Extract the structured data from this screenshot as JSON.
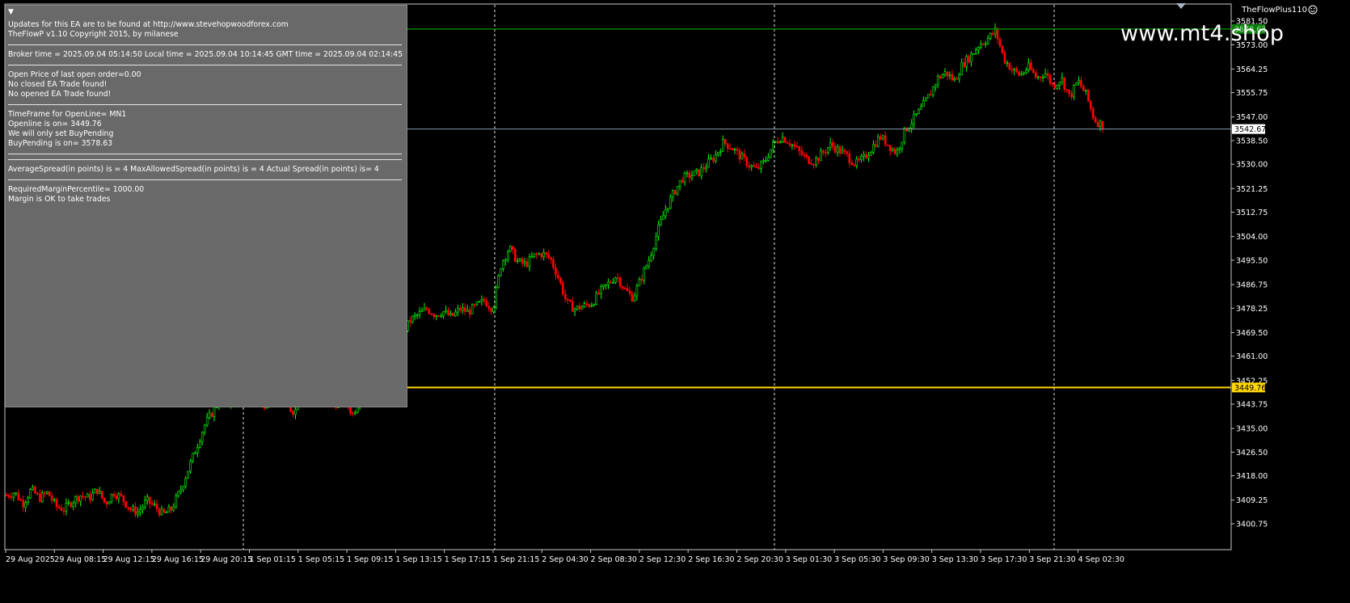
{
  "chart": {
    "indicator_name": "TheFlowPlus110",
    "watermark": "www.mt4.shop",
    "price_axis": {
      "ticks": [
        "3581.50",
        "3573.00",
        "3564.25",
        "3555.75",
        "3547.00",
        "3538.50",
        "3530.00",
        "3521.25",
        "3512.75",
        "3504.00",
        "3495.50",
        "3486.75",
        "3478.25",
        "3469.50",
        "3461.00",
        "3452.25",
        "3443.75",
        "3435.00",
        "3426.50",
        "3418.00",
        "3409.25",
        "3400.75"
      ]
    },
    "time_axis": {
      "labels": [
        "29 Aug 2025",
        "29 Aug 08:15",
        "29 Aug 12:15",
        "29 Aug 16:15",
        "29 Aug 20:15",
        "1 Sep 01:15",
        "1 Sep 05:15",
        "1 Sep 09:15",
        "1 Sep 13:15",
        "1 Sep 17:15",
        "1 Sep 21:15",
        "2 Sep 04:30",
        "2 Sep 08:30",
        "2 Sep 12:30",
        "2 Sep 16:30",
        "2 Sep 20:30",
        "3 Sep 01:30",
        "3 Sep 05:30",
        "3 Sep 09:30",
        "3 Sep 13:30",
        "3 Sep 17:30",
        "3 Sep 21:30",
        "4 Sep 02:30"
      ]
    },
    "lines": {
      "buy_pending": {
        "price": 3578.63,
        "label": "3578.63",
        "color": "#008000"
      },
      "current_price": {
        "price": 3542.67,
        "label": "3542.67",
        "color": "#8a9cb0"
      },
      "open_line": {
        "price": 3449.76,
        "label": "3449.76",
        "color": "#ffd700"
      }
    },
    "colors": {
      "background": "#000000",
      "bull": "#00ff00",
      "bear": "#ff0000",
      "grid": "#ffffff",
      "axis_text": "#ffffff"
    },
    "series_path": [
      3411,
      3412,
      3408,
      3413,
      3410,
      3412,
      3407,
      3406,
      3409,
      3411,
      3410,
      3413,
      3408,
      3412,
      3410,
      3406,
      3405,
      3409,
      3407,
      3404,
      3406,
      3412,
      3420,
      3428,
      3436,
      3441,
      3446,
      3444,
      3448,
      3445,
      3447,
      3443,
      3446,
      3448,
      3443,
      3441,
      3452,
      3446,
      3450,
      3448,
      3444,
      3446,
      3440,
      3447,
      3466,
      3471,
      3467,
      3470,
      3469,
      3474,
      3476,
      3478,
      3476,
      3477,
      3475,
      3478,
      3477,
      3479,
      3481,
      3478,
      3494,
      3500,
      3495,
      3494,
      3497,
      3498,
      3496,
      3489,
      3480,
      3478,
      3479,
      3480,
      3484,
      3487,
      3490,
      3485,
      3482,
      3489,
      3496,
      3506,
      3514,
      3520,
      3525,
      3526,
      3527,
      3530,
      3533,
      3538,
      3536,
      3533,
      3530,
      3528,
      3531,
      3537,
      3540,
      3538,
      3535,
      3532,
      3531,
      3534,
      3537,
      3535,
      3533,
      3530,
      3532,
      3536,
      3540,
      3537,
      3534,
      3542,
      3546,
      3550,
      3555,
      3561,
      3563,
      3560,
      3566,
      3569,
      3573,
      3575,
      3578,
      3568,
      3564,
      3562,
      3565,
      3561,
      3563,
      3558,
      3561,
      3554,
      3560,
      3555,
      3546,
      3544
    ],
    "vertical_grid_x": [
      301,
      612,
      958,
      1304
    ]
  },
  "panel": {
    "lines": [
      "Updates for this EA are to be found at http://www.stevehopwoodforex.com",
      "TheFlowP   v1.10 Copyright 2015, by milanese",
      "---",
      "Broker time = 2025.09.04 05:14:50 Local time = 2025.09.04 10:14:45 GMT time = 2025.09.04 02:14:45",
      "---",
      "Open Price of last open order=0.00",
      "No closed EA Trade found!",
      "No opened EA Trade found!",
      "---",
      "TimeFrame for OpenLine= MN1",
      "Openline is on= 3449.76",
      "We will only set BuyPending",
      "BuyPending is on= 3578.63",
      "---",
      "---",
      "AverageSpread(in points) is = 4 MaxAllowedSpread(in points) is = 4 Actual Spread(in points) is= 4",
      "---",
      "RequiredMarginPercentile= 1000.00",
      "Margin is OK to take trades"
    ]
  }
}
